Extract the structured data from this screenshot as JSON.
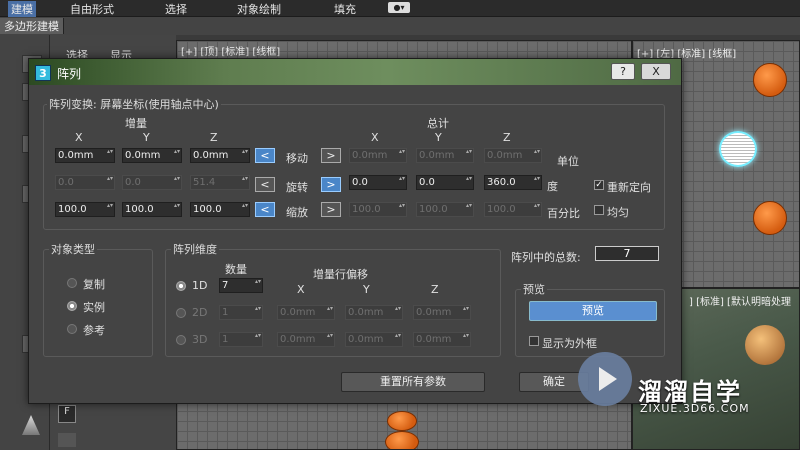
{
  "menubar": {
    "items": [
      "建模",
      "自由形式",
      "选择",
      "对象绘制",
      "填充"
    ],
    "active_index": 0
  },
  "ribbon": {
    "tab": "多边形建模"
  },
  "command_panel": {
    "tabs": [
      "选择",
      "显示"
    ]
  },
  "viewports": {
    "top_left_label": "[+] [顶] [标准] [线框]",
    "top_right_label": "[+] [左] [标准] [线框]",
    "bottom_right_label": "] [标准] [默认明暗处理"
  },
  "dialog": {
    "title": "阵列",
    "help_button": "?",
    "close_button": "X",
    "transform_group": "阵列变换: 屏幕坐标(使用轴点中心)",
    "increment_header": "增量",
    "total_header": "总计",
    "axis": [
      "X",
      "Y",
      "Z"
    ],
    "rows": [
      {
        "label": "移动",
        "unit": "单位",
        "increments": [
          "0.0mm",
          "0.0mm",
          "0.0mm"
        ],
        "totals": [
          "0.0mm",
          "0.0mm",
          "0.0mm"
        ],
        "left_arrow": "<",
        "right_arrow": ">"
      },
      {
        "label": "旋转",
        "unit": "度",
        "increments": [
          "0.0",
          "0.0",
          "51.4"
        ],
        "totals": [
          "0.0",
          "0.0",
          "360.0"
        ],
        "left_arrow": "<",
        "right_arrow": ">"
      },
      {
        "label": "缩放",
        "unit": "百分比",
        "increments": [
          "100.0",
          "100.0",
          "100.0"
        ],
        "totals": [
          "100.0",
          "100.0",
          "100.0"
        ],
        "left_arrow": "<",
        "right_arrow": ">"
      }
    ],
    "reorient_label": "重新定向",
    "reorient_checked": true,
    "uniform_label": "均匀",
    "uniform_checked": false,
    "object_type_group": "对象类型",
    "object_types": [
      "复制",
      "实例",
      "参考"
    ],
    "object_type_selected": 1,
    "dimension_group": "阵列维度",
    "count_header": "数量",
    "offset_header": "增量行偏移",
    "dimensions": [
      {
        "label": "1D",
        "count": "7",
        "offsets": []
      },
      {
        "label": "2D",
        "count": "1",
        "offsets": [
          "0.0mm",
          "0.0mm",
          "0.0mm"
        ]
      },
      {
        "label": "3D",
        "count": "1",
        "offsets": [
          "0.0mm",
          "0.0mm",
          "0.0mm"
        ]
      }
    ],
    "dimension_selected": 0,
    "total_in_array_label": "阵列中的总数:",
    "total_in_array_value": "7",
    "preview_group": "预览",
    "preview_button": "预览",
    "show_as_box_label": "显示为外框",
    "reset_button": "重置所有参数",
    "ok_button": "确定"
  },
  "watermark": {
    "title": "溜溜自学",
    "url": "ZIXUE.3D66.COM"
  }
}
